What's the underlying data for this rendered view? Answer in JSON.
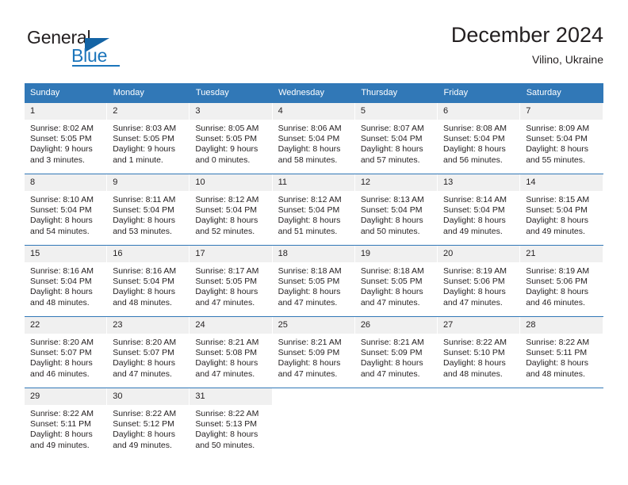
{
  "brand": {
    "name_part1": "General",
    "name_part2": "Blue",
    "accent_color": "#1b75bb",
    "triangle_color": "#1464a5"
  },
  "header": {
    "title": "December 2024",
    "subtitle": "Vilino, Ukraine"
  },
  "theme": {
    "header_row_color": "#3178b7",
    "daynum_band_color": "#f0f0f0",
    "text_color": "#231f20"
  },
  "weekday_headers": [
    "Sunday",
    "Monday",
    "Tuesday",
    "Wednesday",
    "Thursday",
    "Friday",
    "Saturday"
  ],
  "weeks": [
    [
      {
        "day": "1",
        "sunrise": "Sunrise: 8:02 AM",
        "sunset": "Sunset: 5:05 PM",
        "daylight_line1": "Daylight: 9 hours",
        "daylight_line2": "and 3 minutes."
      },
      {
        "day": "2",
        "sunrise": "Sunrise: 8:03 AM",
        "sunset": "Sunset: 5:05 PM",
        "daylight_line1": "Daylight: 9 hours",
        "daylight_line2": "and 1 minute."
      },
      {
        "day": "3",
        "sunrise": "Sunrise: 8:05 AM",
        "sunset": "Sunset: 5:05 PM",
        "daylight_line1": "Daylight: 9 hours",
        "daylight_line2": "and 0 minutes."
      },
      {
        "day": "4",
        "sunrise": "Sunrise: 8:06 AM",
        "sunset": "Sunset: 5:04 PM",
        "daylight_line1": "Daylight: 8 hours",
        "daylight_line2": "and 58 minutes."
      },
      {
        "day": "5",
        "sunrise": "Sunrise: 8:07 AM",
        "sunset": "Sunset: 5:04 PM",
        "daylight_line1": "Daylight: 8 hours",
        "daylight_line2": "and 57 minutes."
      },
      {
        "day": "6",
        "sunrise": "Sunrise: 8:08 AM",
        "sunset": "Sunset: 5:04 PM",
        "daylight_line1": "Daylight: 8 hours",
        "daylight_line2": "and 56 minutes."
      },
      {
        "day": "7",
        "sunrise": "Sunrise: 8:09 AM",
        "sunset": "Sunset: 5:04 PM",
        "daylight_line1": "Daylight: 8 hours",
        "daylight_line2": "and 55 minutes."
      }
    ],
    [
      {
        "day": "8",
        "sunrise": "Sunrise: 8:10 AM",
        "sunset": "Sunset: 5:04 PM",
        "daylight_line1": "Daylight: 8 hours",
        "daylight_line2": "and 54 minutes."
      },
      {
        "day": "9",
        "sunrise": "Sunrise: 8:11 AM",
        "sunset": "Sunset: 5:04 PM",
        "daylight_line1": "Daylight: 8 hours",
        "daylight_line2": "and 53 minutes."
      },
      {
        "day": "10",
        "sunrise": "Sunrise: 8:12 AM",
        "sunset": "Sunset: 5:04 PM",
        "daylight_line1": "Daylight: 8 hours",
        "daylight_line2": "and 52 minutes."
      },
      {
        "day": "11",
        "sunrise": "Sunrise: 8:12 AM",
        "sunset": "Sunset: 5:04 PM",
        "daylight_line1": "Daylight: 8 hours",
        "daylight_line2": "and 51 minutes."
      },
      {
        "day": "12",
        "sunrise": "Sunrise: 8:13 AM",
        "sunset": "Sunset: 5:04 PM",
        "daylight_line1": "Daylight: 8 hours",
        "daylight_line2": "and 50 minutes."
      },
      {
        "day": "13",
        "sunrise": "Sunrise: 8:14 AM",
        "sunset": "Sunset: 5:04 PM",
        "daylight_line1": "Daylight: 8 hours",
        "daylight_line2": "and 49 minutes."
      },
      {
        "day": "14",
        "sunrise": "Sunrise: 8:15 AM",
        "sunset": "Sunset: 5:04 PM",
        "daylight_line1": "Daylight: 8 hours",
        "daylight_line2": "and 49 minutes."
      }
    ],
    [
      {
        "day": "15",
        "sunrise": "Sunrise: 8:16 AM",
        "sunset": "Sunset: 5:04 PM",
        "daylight_line1": "Daylight: 8 hours",
        "daylight_line2": "and 48 minutes."
      },
      {
        "day": "16",
        "sunrise": "Sunrise: 8:16 AM",
        "sunset": "Sunset: 5:04 PM",
        "daylight_line1": "Daylight: 8 hours",
        "daylight_line2": "and 48 minutes."
      },
      {
        "day": "17",
        "sunrise": "Sunrise: 8:17 AM",
        "sunset": "Sunset: 5:05 PM",
        "daylight_line1": "Daylight: 8 hours",
        "daylight_line2": "and 47 minutes."
      },
      {
        "day": "18",
        "sunrise": "Sunrise: 8:18 AM",
        "sunset": "Sunset: 5:05 PM",
        "daylight_line1": "Daylight: 8 hours",
        "daylight_line2": "and 47 minutes."
      },
      {
        "day": "19",
        "sunrise": "Sunrise: 8:18 AM",
        "sunset": "Sunset: 5:05 PM",
        "daylight_line1": "Daylight: 8 hours",
        "daylight_line2": "and 47 minutes."
      },
      {
        "day": "20",
        "sunrise": "Sunrise: 8:19 AM",
        "sunset": "Sunset: 5:06 PM",
        "daylight_line1": "Daylight: 8 hours",
        "daylight_line2": "and 47 minutes."
      },
      {
        "day": "21",
        "sunrise": "Sunrise: 8:19 AM",
        "sunset": "Sunset: 5:06 PM",
        "daylight_line1": "Daylight: 8 hours",
        "daylight_line2": "and 46 minutes."
      }
    ],
    [
      {
        "day": "22",
        "sunrise": "Sunrise: 8:20 AM",
        "sunset": "Sunset: 5:07 PM",
        "daylight_line1": "Daylight: 8 hours",
        "daylight_line2": "and 46 minutes."
      },
      {
        "day": "23",
        "sunrise": "Sunrise: 8:20 AM",
        "sunset": "Sunset: 5:07 PM",
        "daylight_line1": "Daylight: 8 hours",
        "daylight_line2": "and 47 minutes."
      },
      {
        "day": "24",
        "sunrise": "Sunrise: 8:21 AM",
        "sunset": "Sunset: 5:08 PM",
        "daylight_line1": "Daylight: 8 hours",
        "daylight_line2": "and 47 minutes."
      },
      {
        "day": "25",
        "sunrise": "Sunrise: 8:21 AM",
        "sunset": "Sunset: 5:09 PM",
        "daylight_line1": "Daylight: 8 hours",
        "daylight_line2": "and 47 minutes."
      },
      {
        "day": "26",
        "sunrise": "Sunrise: 8:21 AM",
        "sunset": "Sunset: 5:09 PM",
        "daylight_line1": "Daylight: 8 hours",
        "daylight_line2": "and 47 minutes."
      },
      {
        "day": "27",
        "sunrise": "Sunrise: 8:22 AM",
        "sunset": "Sunset: 5:10 PM",
        "daylight_line1": "Daylight: 8 hours",
        "daylight_line2": "and 48 minutes."
      },
      {
        "day": "28",
        "sunrise": "Sunrise: 8:22 AM",
        "sunset": "Sunset: 5:11 PM",
        "daylight_line1": "Daylight: 8 hours",
        "daylight_line2": "and 48 minutes."
      }
    ],
    [
      {
        "day": "29",
        "sunrise": "Sunrise: 8:22 AM",
        "sunset": "Sunset: 5:11 PM",
        "daylight_line1": "Daylight: 8 hours",
        "daylight_line2": "and 49 minutes."
      },
      {
        "day": "30",
        "sunrise": "Sunrise: 8:22 AM",
        "sunset": "Sunset: 5:12 PM",
        "daylight_line1": "Daylight: 8 hours",
        "daylight_line2": "and 49 minutes."
      },
      {
        "day": "31",
        "sunrise": "Sunrise: 8:22 AM",
        "sunset": "Sunset: 5:13 PM",
        "daylight_line1": "Daylight: 8 hours",
        "daylight_line2": "and 50 minutes."
      },
      {
        "day": "",
        "sunrise": "",
        "sunset": "",
        "daylight_line1": "",
        "daylight_line2": ""
      },
      {
        "day": "",
        "sunrise": "",
        "sunset": "",
        "daylight_line1": "",
        "daylight_line2": ""
      },
      {
        "day": "",
        "sunrise": "",
        "sunset": "",
        "daylight_line1": "",
        "daylight_line2": ""
      },
      {
        "day": "",
        "sunrise": "",
        "sunset": "",
        "daylight_line1": "",
        "daylight_line2": ""
      }
    ]
  ]
}
